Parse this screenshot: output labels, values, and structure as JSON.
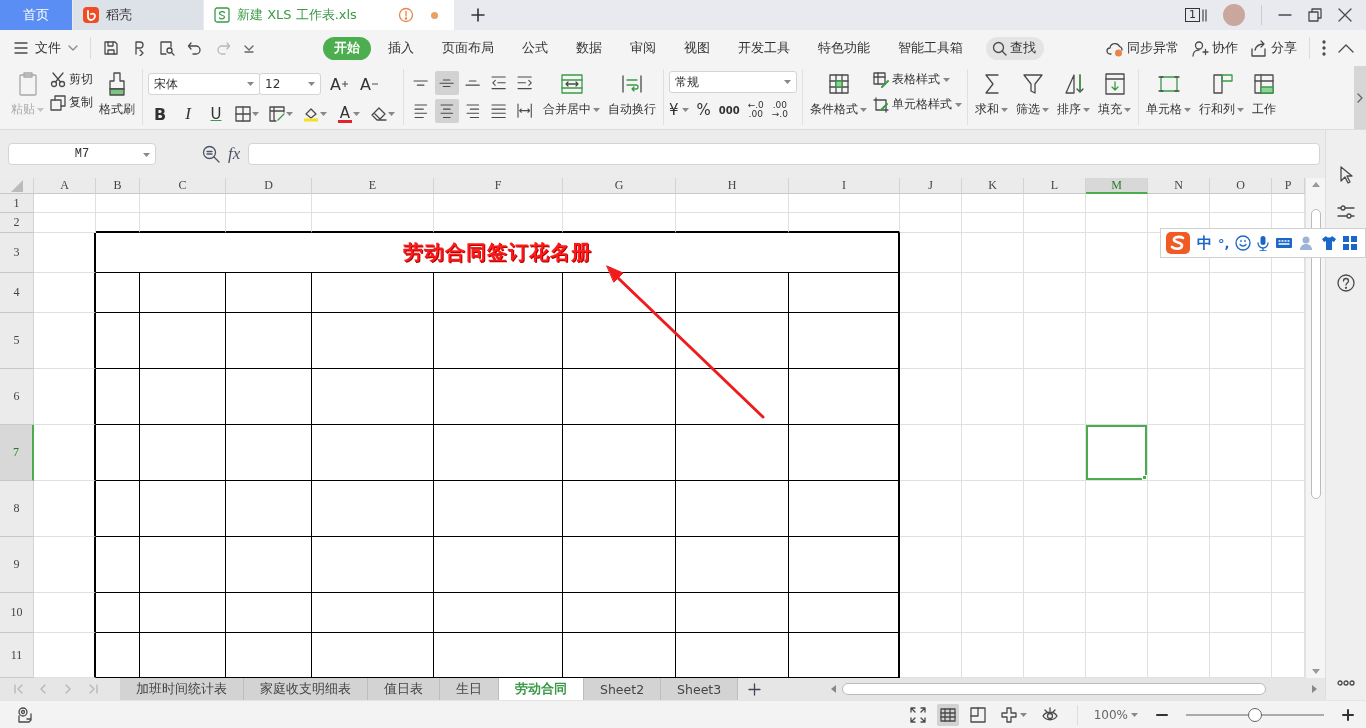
{
  "title_bar": {
    "tabs": [
      {
        "label": "首页",
        "kind": "home",
        "selected": false
      },
      {
        "label": "稻壳",
        "kind": "app",
        "selected": false
      },
      {
        "label": "新建 XLS 工作表.xls",
        "kind": "document",
        "selected": true,
        "warning": true,
        "modified": true
      }
    ],
    "window_count": "1"
  },
  "menu_bar": {
    "file_menu": "文件",
    "redo_disabled": true,
    "tabs": [
      {
        "label": "开始",
        "selected": true
      },
      {
        "label": "插入",
        "selected": false
      },
      {
        "label": "页面布局",
        "selected": false
      },
      {
        "label": "公式",
        "selected": false
      },
      {
        "label": "数据",
        "selected": false
      },
      {
        "label": "审阅",
        "selected": false
      },
      {
        "label": "视图",
        "selected": false
      },
      {
        "label": "开发工具",
        "selected": false
      },
      {
        "label": "特色功能",
        "selected": false
      },
      {
        "label": "智能工具箱",
        "selected": false
      }
    ],
    "search": "查找",
    "actions": [
      {
        "label": "同步异常",
        "kind": "sync"
      },
      {
        "label": "协作",
        "kind": "collaborate"
      },
      {
        "label": "分享",
        "kind": "share"
      }
    ]
  },
  "ribbon": {
    "paste": {
      "label": "粘贴",
      "disabled": true
    },
    "cut": "剪切",
    "copy": "复制",
    "format_painter": "格式刷",
    "font": {
      "name": "宋体",
      "size": "12",
      "grow": "A",
      "shrink": "A",
      "bold": "B",
      "italic": "I",
      "underline": "U",
      "font_color": "A"
    },
    "align_buttons": [
      {
        "kind": "top",
        "selected": false
      },
      {
        "kind": "middle",
        "selected": true
      },
      {
        "kind": "bottom",
        "selected": false
      },
      {
        "kind": "outdent",
        "selected": false
      },
      {
        "kind": "indent",
        "selected": false
      },
      {
        "kind": "left",
        "selected": false
      },
      {
        "kind": "center",
        "selected": true
      },
      {
        "kind": "right",
        "selected": false
      },
      {
        "kind": "justify",
        "selected": false
      },
      {
        "kind": "distributed",
        "selected": false
      }
    ],
    "merge": "合并居中",
    "wrap": "自动换行",
    "number": {
      "format": "常规",
      "currency": "¥",
      "percent": "%",
      "thousands": "000",
      "decimals": [
        {
          "top": "←.0",
          "bottom": ".00"
        },
        {
          "top": ".00",
          "bottom": "→.0"
        }
      ]
    },
    "styles": {
      "conditional": "条件格式",
      "table_style": "表格样式",
      "cell_style": "单元格样式"
    },
    "editing": [
      {
        "label": "求和",
        "kind": "sum"
      },
      {
        "label": "筛选",
        "kind": "filter"
      },
      {
        "label": "排序",
        "kind": "sort"
      },
      {
        "label": "填充",
        "kind": "fill"
      }
    ],
    "cells": [
      {
        "label": "单元格",
        "kind": "cell"
      },
      {
        "label": "行和列",
        "kind": "rows"
      },
      {
        "label": "工作",
        "kind": "sheet"
      }
    ]
  },
  "formula_bar": {
    "name_box": "M7",
    "function_label": "fx"
  },
  "sheet": {
    "columns": [
      {
        "label": "A",
        "selected": false
      },
      {
        "label": "B",
        "selected": false
      },
      {
        "label": "C",
        "selected": false
      },
      {
        "label": "D",
        "selected": false
      },
      {
        "label": "E",
        "selected": false
      },
      {
        "label": "F",
        "selected": false
      },
      {
        "label": "G",
        "selected": false
      },
      {
        "label": "H",
        "selected": false
      },
      {
        "label": "I",
        "selected": false
      },
      {
        "label": "J",
        "selected": false
      },
      {
        "label": "K",
        "selected": false
      },
      {
        "label": "L",
        "selected": false
      },
      {
        "label": "M",
        "selected": true
      },
      {
        "label": "N",
        "selected": false
      },
      {
        "label": "O",
        "selected": false
      },
      {
        "label": "P",
        "selected": false
      }
    ],
    "rows": [
      {
        "label": "1",
        "selected": false
      },
      {
        "label": "2",
        "selected": false
      },
      {
        "label": "3",
        "selected": false
      },
      {
        "label": "4",
        "selected": false
      },
      {
        "label": "5",
        "selected": false
      },
      {
        "label": "6",
        "selected": false
      },
      {
        "label": "7",
        "selected": true
      },
      {
        "label": "8",
        "selected": false
      },
      {
        "label": "9",
        "selected": false
      },
      {
        "label": "10",
        "selected": false
      },
      {
        "label": "11",
        "selected": false
      }
    ],
    "table_title": "劳动合同签订花名册"
  },
  "sheet_tabs": {
    "navigation_disabled": true,
    "tabs": [
      {
        "label": "加班时间统计表",
        "selected": false
      },
      {
        "label": "家庭收支明细表",
        "selected": false
      },
      {
        "label": "值日表",
        "selected": false
      },
      {
        "label": "生日",
        "selected": false
      },
      {
        "label": "劳动合同",
        "selected": true
      },
      {
        "label": "Sheet2",
        "selected": false
      },
      {
        "label": "Sheet3",
        "selected": false
      }
    ]
  },
  "status_bar": {
    "view_buttons": [
      {
        "kind": "fullscreen",
        "selected": false
      },
      {
        "kind": "normal",
        "selected": true
      },
      {
        "kind": "page",
        "selected": false
      },
      {
        "kind": "layout",
        "selected": false
      },
      {
        "kind": "reading",
        "selected": false
      }
    ],
    "zoom": {
      "label": "100%",
      "level": 0.5
    }
  },
  "ime_toolbar": {
    "mode": "中",
    "punctuation": "°,"
  }
}
